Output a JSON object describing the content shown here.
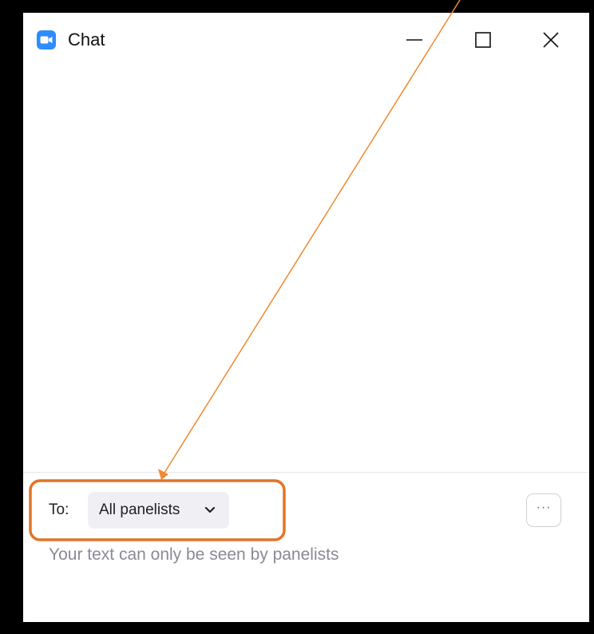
{
  "window": {
    "title": "Chat",
    "icon": "zoom-camera-icon",
    "controls": [
      "minimize-icon",
      "maximize-icon",
      "close-icon"
    ]
  },
  "composer": {
    "to_label": "To:",
    "recipient": "All panelists",
    "recipient_icon": "chevron-down-icon",
    "more_label": "···",
    "hint": "Your text can only be seen by panelists"
  },
  "annotation": {
    "color": "#e27428",
    "arrow_color": "#f0892f"
  },
  "colors": {
    "accent": "#2d8cff"
  }
}
